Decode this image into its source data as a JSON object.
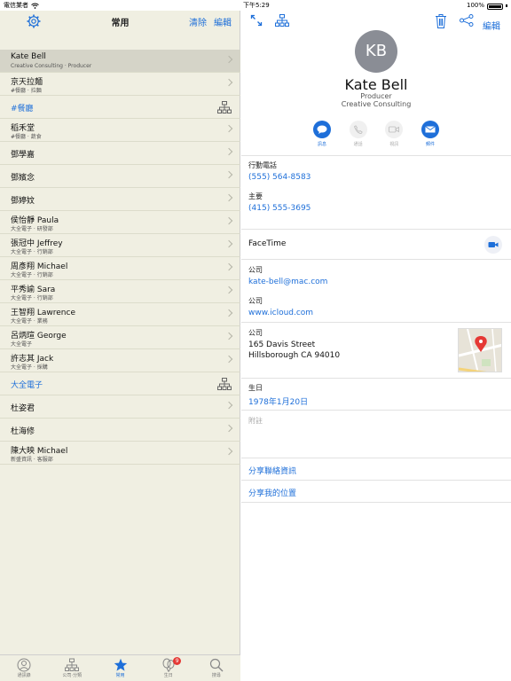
{
  "status": {
    "carrier": "電信業者",
    "time": "下午5:29",
    "battery": "100%"
  },
  "left": {
    "title": "常用",
    "clear_label": "清除",
    "edit_label": "編輯",
    "rows": [
      {
        "name": "Kate Bell",
        "sub": "Creative Consulting · Producer",
        "type": "contact",
        "selected": true
      },
      {
        "name": "京天拉麵",
        "sub": "#餐廳 · 拉麵",
        "type": "contact"
      },
      {
        "name": "#餐廳",
        "sub": "",
        "type": "group"
      },
      {
        "name": "稻禾堂",
        "sub": "#餐廳 · 蔬食",
        "type": "contact"
      },
      {
        "name": "鄧學嘉",
        "sub": "",
        "type": "contact"
      },
      {
        "name": "鄧嬪念",
        "sub": "",
        "type": "contact"
      },
      {
        "name": "鄧婷妏",
        "sub": "",
        "type": "contact"
      },
      {
        "name": "侯怡靜 Paula",
        "sub": "大全電子 · 研發部",
        "type": "contact"
      },
      {
        "name": "張冠中 Jeffrey",
        "sub": "大全電子 · 行銷部",
        "type": "contact"
      },
      {
        "name": "周彥翔 Michael",
        "sub": "大全電子 · 行銷部",
        "type": "contact"
      },
      {
        "name": "平秀諭 Sara",
        "sub": "大全電子 · 行銷部",
        "type": "contact"
      },
      {
        "name": "王智翔 Lawrence",
        "sub": "大全電子 · 業務",
        "type": "contact"
      },
      {
        "name": "呂炳瑄 George",
        "sub": "大全電子",
        "type": "contact"
      },
      {
        "name": "許志其 Jack",
        "sub": "大全電子 · 採購",
        "type": "contact"
      },
      {
        "name": "大全電子",
        "sub": "",
        "type": "group"
      },
      {
        "name": "杜姿君",
        "sub": "",
        "type": "contact"
      },
      {
        "name": "杜海修",
        "sub": "",
        "type": "contact"
      },
      {
        "name": "陳大映 Michael",
        "sub": "新盛資訊 · 客服部",
        "type": "contact"
      }
    ]
  },
  "tabs": [
    {
      "label": "通訊錄",
      "icon": "person-circle-icon"
    },
    {
      "label": "公司·分類",
      "icon": "org-chart-icon"
    },
    {
      "label": "常用",
      "icon": "star-icon",
      "active": true
    },
    {
      "label": "生日",
      "icon": "balloon-icon",
      "badge": "9"
    },
    {
      "label": "搜尋",
      "icon": "search-icon"
    }
  ],
  "contact": {
    "initials": "KB",
    "name": "Kate Bell",
    "title": "Producer",
    "organization": "Creative Consulting",
    "edit_label": "編輯",
    "actions": [
      {
        "label": "訊息",
        "icon": "message-icon",
        "enabled": true
      },
      {
        "label": "通話",
        "icon": "phone-icon",
        "enabled": false
      },
      {
        "label": "視訊",
        "icon": "video-icon",
        "enabled": false
      },
      {
        "label": "郵件",
        "icon": "mail-icon",
        "enabled": true
      }
    ],
    "mobile_label": "行動電話",
    "mobile_value": "(555) 564-8583",
    "main_label": "主要",
    "main_value": "(415) 555-3695",
    "facetime_label": "FaceTime",
    "email_label": "公司",
    "email_value": "kate-bell@mac.com",
    "url_label": "公司",
    "url_value": "www.icloud.com",
    "address_label": "公司",
    "address_line1": "165 Davis Street",
    "address_line2": "Hillsborough CA 94010",
    "birthday_label": "生日",
    "birthday_value": "1978年1月20日",
    "notes_placeholder": "附註",
    "share_contact": "分享聯絡資訊",
    "share_location": "分享我的位置"
  },
  "colors": {
    "accent": "#1e6fd9",
    "sidebar_bg": "#f0efe2",
    "badge": "#e53935"
  }
}
